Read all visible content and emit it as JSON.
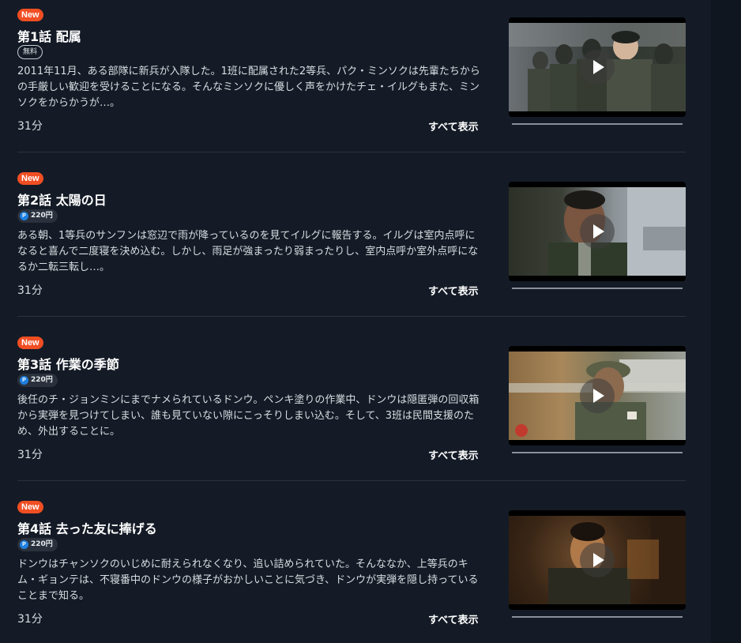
{
  "episodes": [
    {
      "new_label": "New",
      "title": "第1話 配属",
      "badge_type": "free",
      "badge_text": "無料",
      "description": "2011年11月、ある部隊に新兵が入隊した。1班に配属された2等兵、パク・ミンソクは先輩たちからの手厳しい歓迎を受けることになる。そんなミンソクに優しく声をかけたチェ・イルグもまた、ミンソクをからかうが…。",
      "duration": "31分",
      "show_all": "すべて表示"
    },
    {
      "new_label": "New",
      "title": "第2話 太陽の日",
      "badge_type": "price",
      "point_icon": "P",
      "badge_text": "220円",
      "description": "ある朝、1等兵のサンフンは窓辺で雨が降っているのを見てイルグに報告する。イルグは室内点呼になると喜んで二度寝を決め込む。しかし、雨足が強まったり弱まったりし、室内点呼か室外点呼になるか二転三転し…。",
      "duration": "31分",
      "show_all": "すべて表示"
    },
    {
      "new_label": "New",
      "title": "第3話 作業の季節",
      "badge_type": "price",
      "point_icon": "P",
      "badge_text": "220円",
      "description": "後任のチ・ジョンミンにまでナメられているドンウ。ペンキ塗りの作業中、ドンウは隠匿弾の回収箱から実弾を見つけてしまい、誰も見ていない隙にこっそりしまい込む。そして、3班は民間支援のため、外出することに。",
      "duration": "31分",
      "show_all": "すべて表示"
    },
    {
      "new_label": "New",
      "title": "第4話 去った友に捧げる",
      "badge_type": "price",
      "point_icon": "P",
      "badge_text": "220円",
      "description": "ドンウはチャンソクのいじめに耐えられなくなり、追い詰められていた。そんななか、上等兵のキム・ギョンテは、不寝番中のドンウの様子がおかしいことに気づき、ドンウが実弾を隠し持っていることまで知る。",
      "duration": "31分",
      "show_all": "すべて表示"
    }
  ]
}
